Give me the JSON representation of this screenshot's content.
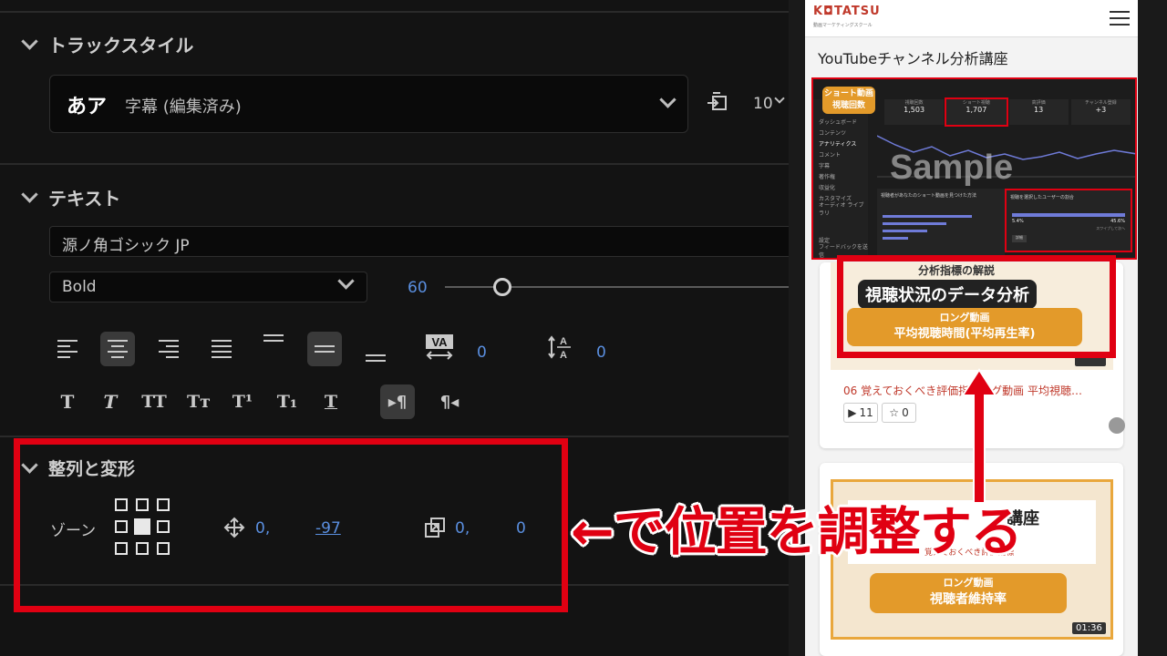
{
  "left_panel": {
    "track_style": {
      "title": "トラックスタイル",
      "preview": "あア",
      "name": "字幕 (編集済み)",
      "size_value": "10"
    },
    "text_section": {
      "title": "テキスト",
      "font_family": "源ノ角ゴシック JP",
      "font_style": "Bold",
      "font_size": "60",
      "kerning_value": "0",
      "leading_value": "0",
      "style_buttons": [
        "T",
        "T",
        "TT",
        "Tт",
        "T¹",
        "T₁",
        "T"
      ]
    },
    "align_section": {
      "title": "整列と変形",
      "zone_label": "ゾーン",
      "position_x": "0,",
      "position_y": "-97",
      "scale_x": "0,",
      "scale_y": "0"
    }
  },
  "annotation": {
    "text": "←で位置を調整する",
    "color": "#e00012"
  },
  "mobile": {
    "logo": "K◘TATSU",
    "logo_sub": "動画マーケティングスクール",
    "page_title": "YouTubeチャンネル分析講座",
    "thumb1": {
      "badge": "ショート動画\n視聴回数",
      "watermark": "Sample",
      "stats": [
        {
          "label": "視聴回数",
          "value": "1,503"
        },
        {
          "label": "ショート視聴",
          "value": "1,707"
        },
        {
          "label": "高評価",
          "value": "13"
        },
        {
          "label": "チャンネル登録",
          "value": "+3"
        }
      ],
      "sidebar": [
        "ダッシュボード",
        "コンテンツ",
        "アナリティクス",
        "コメント",
        "字幕",
        "著作権",
        "収益化",
        "カスタマイズ",
        "オーディオ ライブラリ",
        "設定",
        "フィードバックを送信"
      ],
      "chart_title": "視聴者があなたのショート動画を見つけた方法",
      "rate_title": "視聴を選択したユーザーの割合",
      "rate_left": "5.4%",
      "rate_right": "45.6%",
      "rate_label": "スワイプして次へ",
      "button_label": "詳細"
    },
    "video1": {
      "subtitle_top": "分析指標の解説",
      "heading": "視聴状況のデータ分析",
      "orange_line1": "ロング動画",
      "orange_line2": "平均視聴時間(平均再生率)",
      "title": "06 覚えておくべき評価指標ング動画 平均視聴…",
      "plays": "11",
      "stars": "0"
    },
    "video2": {
      "heading_partial": "講座",
      "subheading_partial": "覚えておくべき評価指標",
      "orange_line1": "ロング動画",
      "orange_line2": "視聴者維持率",
      "duration": "01:36"
    }
  }
}
